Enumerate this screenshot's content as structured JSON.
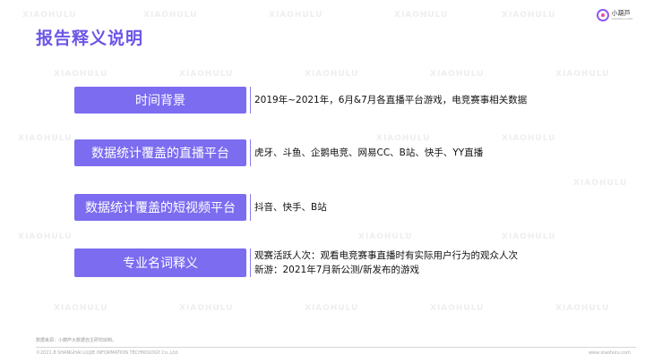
{
  "title": "报告释义说明",
  "logo": {
    "name_cn": "小葫芦",
    "name_en": "XIAOHULU.COM"
  },
  "watermark_text": "XIAOHULU",
  "rows": [
    {
      "label": "时间背景",
      "lines": [
        "2019年~2021年，6月&7月各直播平台游戏，电竞赛事相关数据"
      ]
    },
    {
      "label": "数据统计覆盖的直播平台",
      "lines": [
        "虎牙、斗鱼、企鹅电竞、网易CC、B站、快手、YY直播"
      ]
    },
    {
      "label": "数据统计覆盖的短视频平台",
      "lines": [
        "抖音、快手、B站"
      ]
    },
    {
      "label": "专业名词释义",
      "lines": [
        "观赛活跃人次：观看电竞赛事直播时有实际用户行为的观众人次",
        "新游：2021年7月新公测/新发布的游戏"
      ]
    }
  ],
  "footer": {
    "source": "数据来源：小葫芦大数据自主研究绘制。",
    "copyright": "©2021.8 SHANGHAI LIUJIE INFORMATION  TECHNOLOGY Co.,Ltd.",
    "url": "www.xiaohulu.com"
  }
}
